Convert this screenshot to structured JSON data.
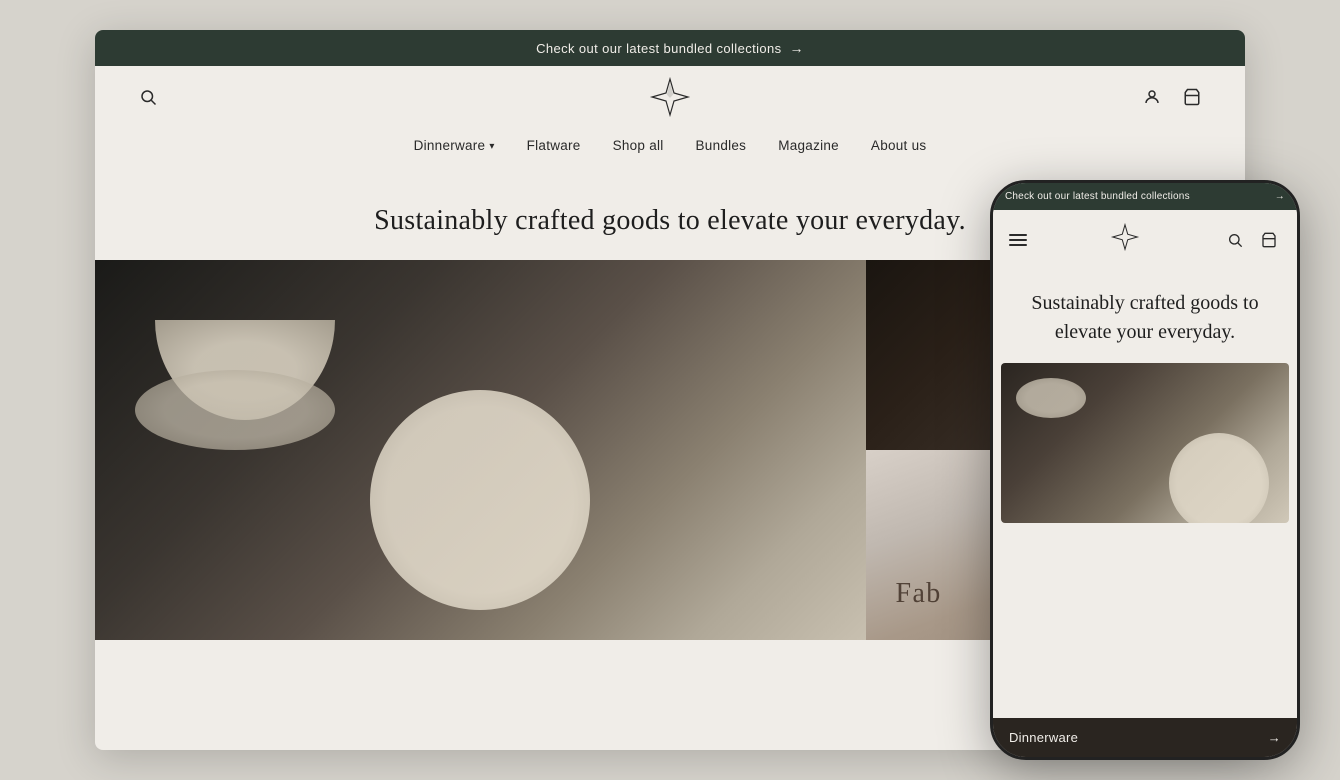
{
  "announcement": {
    "text": "Check out our latest bundled collections",
    "arrow": "→"
  },
  "nav": {
    "items": [
      {
        "label": "Dinnerware",
        "hasDropdown": true
      },
      {
        "label": "Flatware",
        "hasDropdown": false
      },
      {
        "label": "Shop all",
        "hasDropdown": false
      },
      {
        "label": "Bundles",
        "hasDropdown": false
      },
      {
        "label": "Magazine",
        "hasDropdown": false
      },
      {
        "label": "About us",
        "hasDropdown": false
      }
    ]
  },
  "hero": {
    "headline": "Sustainably crafted goods to elevate your everyday."
  },
  "phone": {
    "announcement": {
      "text": "Check out our latest bundled collections",
      "arrow": "→"
    },
    "hero_text": "Sustainably crafted goods to elevate your everyday.",
    "bottom_bar_label": "Dinnerware",
    "bottom_bar_arrow": "→"
  }
}
